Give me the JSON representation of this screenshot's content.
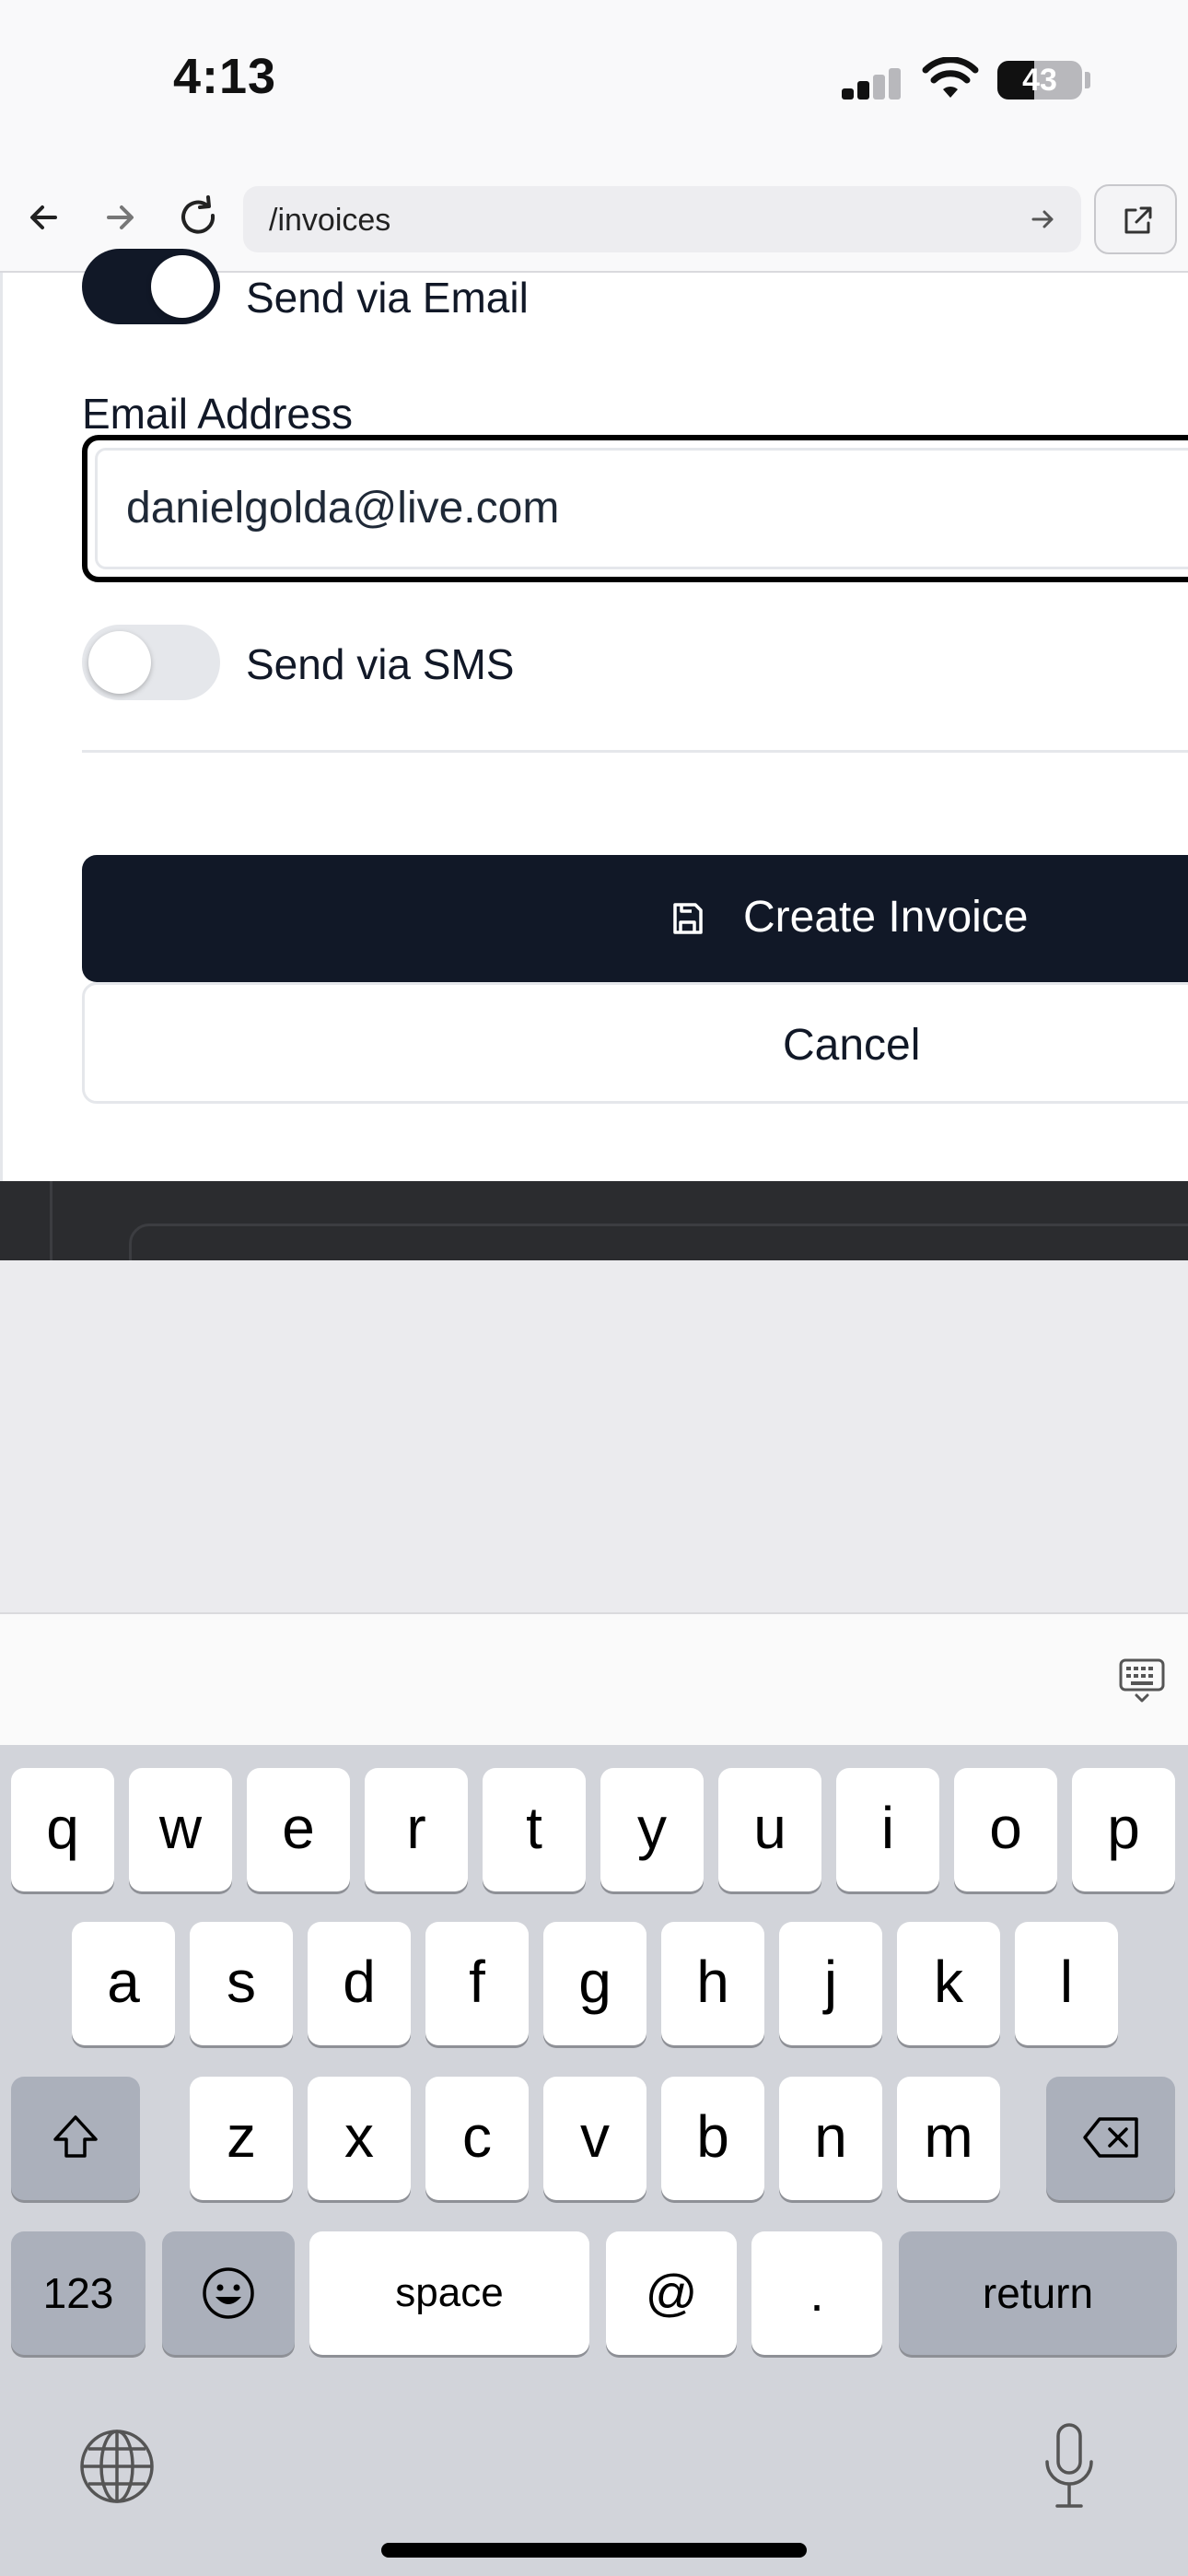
{
  "status_bar": {
    "time": "4:13",
    "battery": "43",
    "battery_level": 0.43
  },
  "browser": {
    "url": "/invoices"
  },
  "form": {
    "email_toggle": {
      "label": "Send via Email",
      "on": true
    },
    "email_field": {
      "label": "Email Address",
      "value": "danielgolda@live.com"
    },
    "sms_toggle": {
      "label": "Send via SMS",
      "on": false
    },
    "create_button": "Create Invoice",
    "cancel_button": "Cancel"
  },
  "keyboard": {
    "row1": [
      "q",
      "w",
      "e",
      "r",
      "t",
      "y",
      "u",
      "i",
      "o",
      "p"
    ],
    "row2": [
      "a",
      "s",
      "d",
      "f",
      "g",
      "h",
      "j",
      "k",
      "l"
    ],
    "row3": [
      "z",
      "x",
      "c",
      "v",
      "b",
      "n",
      "m"
    ],
    "numbers_key": "123",
    "space_key": "space",
    "at_key": "@",
    "dot_key": ".",
    "return_key": "return"
  },
  "icons": {
    "back": "arrow-left-icon",
    "forward": "arrow-right-icon",
    "reload": "reload-icon",
    "go": "arrow-right-icon",
    "external": "external-link-icon",
    "save": "save-icon",
    "shift": "shift-icon",
    "delete": "delete-icon",
    "emoji": "emoji-icon",
    "globe": "globe-icon",
    "mic": "mic-icon",
    "hide_keyboard": "keyboard-hide-icon"
  },
  "colors": {
    "primary": "#111827",
    "accent_border": "#000000",
    "keyboard_bg": "#d2d4da"
  }
}
